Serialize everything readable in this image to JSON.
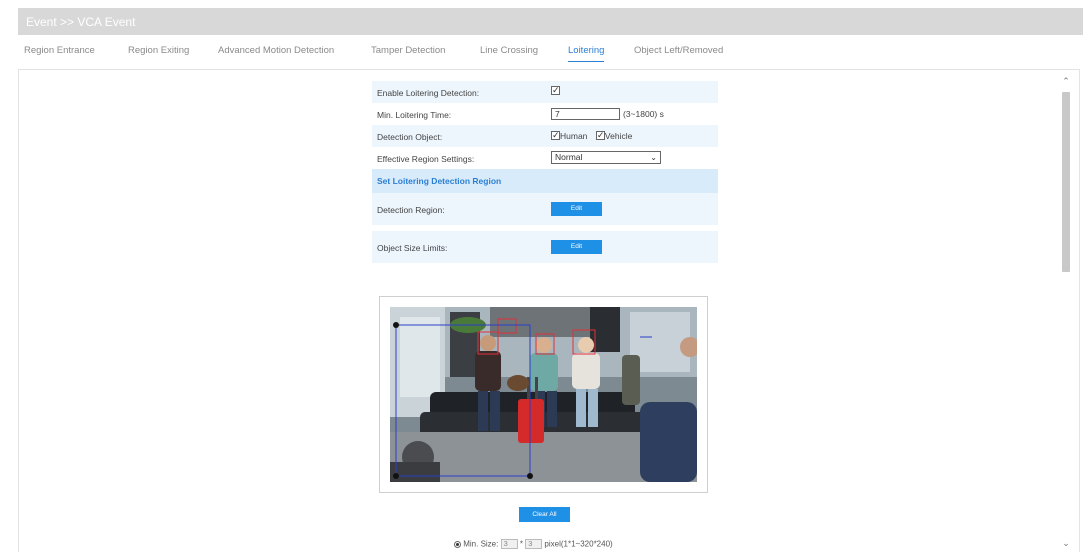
{
  "header": {
    "title": "Event >> VCA Event"
  },
  "tabs": [
    {
      "label": "Region Entrance",
      "active": false
    },
    {
      "label": "Region Exiting",
      "active": false
    },
    {
      "label": "Advanced Motion Detection",
      "active": false
    },
    {
      "label": "Tamper Detection",
      "active": false
    },
    {
      "label": "Line Crossing",
      "active": false
    },
    {
      "label": "Loitering",
      "active": true
    },
    {
      "label": "Object Left/Removed",
      "active": false
    }
  ],
  "form": {
    "enable_label": "Enable Loitering Detection:",
    "enable_checked": true,
    "min_time_label": "Min. Loitering Time:",
    "min_time_value": "7",
    "min_time_range": "(3~1800) s",
    "detection_object_label": "Detection Object:",
    "human_label": "Human",
    "human_checked": true,
    "vehicle_label": "Vehicle",
    "vehicle_checked": true,
    "effective_region_label": "Effective Region Settings:",
    "effective_region_value": "Normal",
    "section_title": "Set Loitering Detection Region",
    "detection_region_label": "Detection Region:",
    "detection_region_button": "Edit",
    "object_size_label": "Object Size Limits:",
    "object_size_button": "Edit"
  },
  "clear_all_label": "Clear All",
  "min_size": {
    "label": "Min. Size:",
    "width": "3",
    "sep": "*",
    "height": "3",
    "unit": "pixel(1*1~320*240)"
  },
  "colors": {
    "accent": "#1e90e6",
    "tab_active": "#2b7fd4",
    "row_alt": "#edf6fd",
    "section_bg": "#d8ebfa",
    "region_line": "#2a3fc8",
    "detect_box": "#e0303a"
  },
  "icons": {
    "scroll_up": "chevron-up-icon",
    "scroll_down": "chevron-down-icon",
    "select_arrow": "chevron-down-icon"
  }
}
